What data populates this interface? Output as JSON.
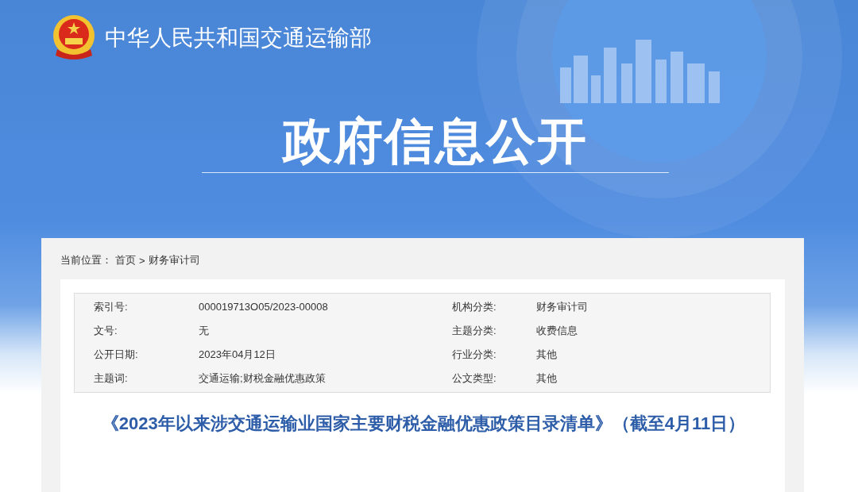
{
  "header": {
    "ministry": "中华人民共和国交通运输部",
    "section_title": "政府信息公开"
  },
  "breadcrumb": {
    "label": "当前位置：",
    "items": [
      "首页",
      "财务审计司"
    ],
    "separator": ">"
  },
  "meta": [
    {
      "label": "索引号:",
      "value": "000019713O05/2023-00008",
      "label2": "机构分类:",
      "value2": "财务审计司"
    },
    {
      "label": "文号:",
      "value": "无",
      "label2": "主题分类:",
      "value2": "收费信息"
    },
    {
      "label": "公开日期:",
      "value": "2023年04月12日",
      "label2": "行业分类:",
      "value2": "其他"
    },
    {
      "label": "主题词:",
      "value": "交通运输;财税金融优惠政策",
      "label2": "公文类型:",
      "value2": "其他"
    }
  ],
  "article": {
    "title": "《2023年以来涉交通运输业国家主要财税金融优惠政策目录清单》（截至4月11日）"
  }
}
